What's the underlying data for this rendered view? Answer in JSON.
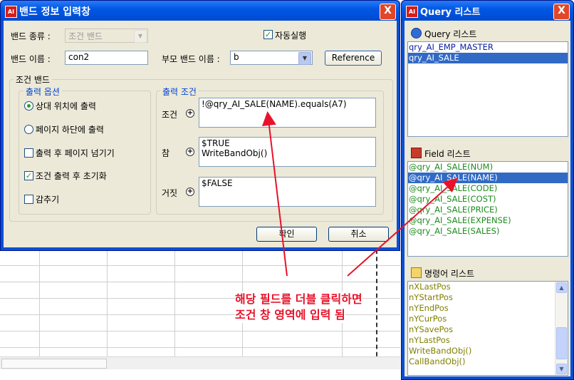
{
  "dialog": {
    "title": "밴드 정보 입력창",
    "close_label": "X",
    "band_type": {
      "label": "밴드 종류 :",
      "value": "조건 밴드"
    },
    "auto_run": {
      "label": "자동실행",
      "checked": true
    },
    "band_name": {
      "label": "밴드 이름 :",
      "value": "con2"
    },
    "parent_band": {
      "label": "부모 밴드 이름 :",
      "value": "b"
    },
    "reference_label": "Reference",
    "condition_band_group": "조건 밴드",
    "output_options": {
      "title": "출력 옵션",
      "radio_relative": "상대 위치에 출력",
      "radio_page_bottom": "페이지 하단에 출력",
      "chk_page_break": "출력 후 페이지 넘기기",
      "chk_reset": "조건 출력 후 초기화",
      "chk_hide": "감추기"
    },
    "output_conditions": {
      "title": "출력 조건",
      "cond_label": "조건",
      "cond_value": "!@qry_AI_SALE(NAME).equals(A7)",
      "true_label": "참",
      "true_value": "$TRUE\nWriteBandObj()",
      "false_label": "거짓",
      "false_value": "$FALSE"
    },
    "ok_label": "확인",
    "cancel_label": "취소"
  },
  "query_panel": {
    "title": "Query 리스트",
    "close_label": "X",
    "query_section": "Query 리스트",
    "queries": [
      {
        "label": "qry_AI_EMP_MASTER",
        "selected": false
      },
      {
        "label": "qry_AI_SALE",
        "selected": true
      }
    ],
    "field_section": "Field 리스트",
    "fields": [
      {
        "label": "@qry_AI_SALE(NUM)",
        "selected": false
      },
      {
        "label": "@qry_AI_SALE(NAME)",
        "selected": true
      },
      {
        "label": "@qry_AI_SALE(CODE)",
        "selected": false
      },
      {
        "label": "@qry_AI_SALE(COST)",
        "selected": false
      },
      {
        "label": "@qry_AI_SALE(PRICE)",
        "selected": false
      },
      {
        "label": "@qry_AI_SALE(EXPENSE)",
        "selected": false
      },
      {
        "label": "@qry_AI_SALE(SALES)",
        "selected": false
      }
    ],
    "command_section": "명령어 리스트",
    "commands": [
      "nXLastPos",
      "nYStartPos",
      "nYEndPos",
      "nYCurPos",
      "nYSavePos",
      "nYLastPos",
      "WriteBandObj()",
      "CallBandObj()"
    ]
  },
  "annotation": {
    "line1": "해당 필드를 더블 클릭하면",
    "line2": "조건 창 영역에 입력 됨",
    "color": "#e8122a"
  },
  "colors": {
    "selection": "#316ac5",
    "field_text": "#1f8b1f",
    "command_text": "#808000",
    "titlebar": "#0058e6"
  }
}
